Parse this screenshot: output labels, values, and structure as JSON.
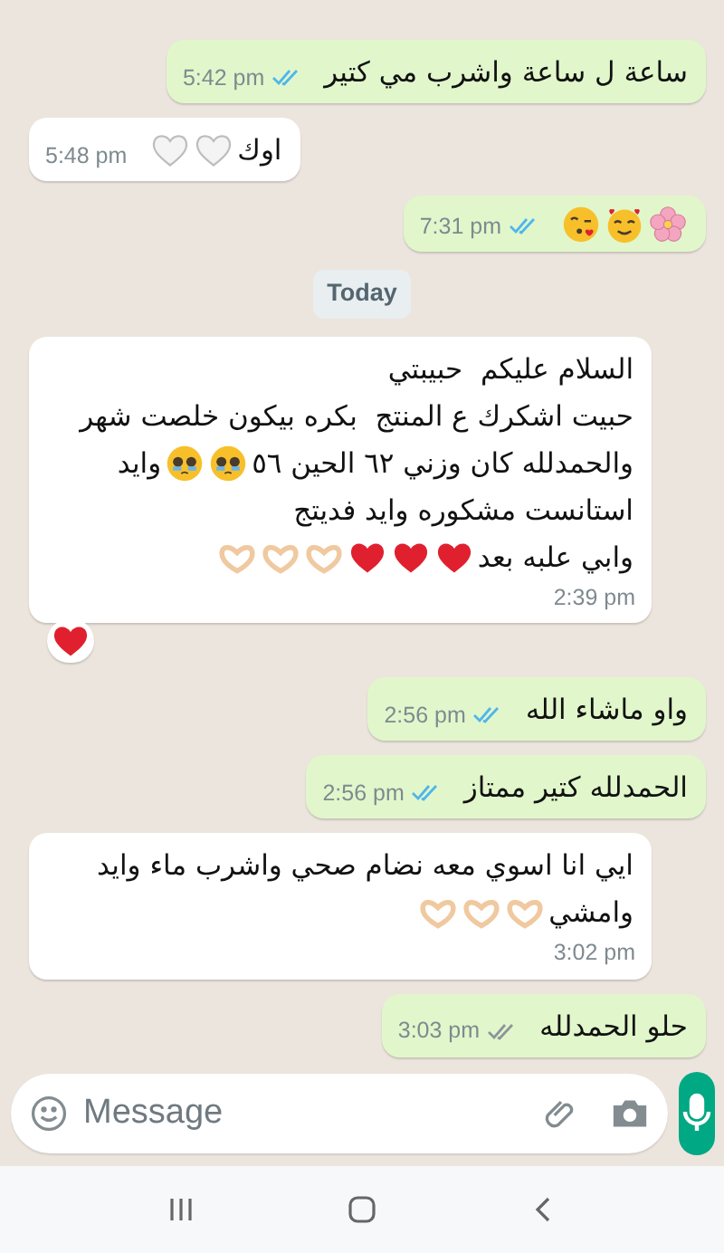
{
  "messages": [
    {
      "kind": "outgoing",
      "lines": [
        [
          {
            "kind": "text",
            "text": "ساعة ل ساعة واشرب مي كتير"
          }
        ]
      ],
      "time": "5:42 pm",
      "read": true
    },
    {
      "kind": "incoming",
      "lines": [
        [
          {
            "kind": "text",
            "text": "اوك"
          },
          {
            "kind": "outlineheart"
          },
          {
            "kind": "outlineheart"
          }
        ]
      ],
      "time": "5:48 pm"
    },
    {
      "kind": "outgoing",
      "lines": [
        [
          {
            "kind": "blossom"
          },
          {
            "kind": "lovestruck"
          },
          {
            "kind": "kiss"
          }
        ]
      ],
      "time": "7:31 pm",
      "read": true
    },
    {
      "kind": "date",
      "text": "Today"
    },
    {
      "kind": "incoming",
      "lines": [
        [
          {
            "kind": "text",
            "text": "السلام عليكم  حبيبتي"
          }
        ],
        [
          {
            "kind": "text",
            "text": "حبيت اشكرك ع المنتج  بكره بيكون خلصت شهر"
          }
        ],
        [
          {
            "kind": "text",
            "text": "والحمدلله كان وزني ٦٢ الحين ٥٦"
          },
          {
            "kind": "pleading"
          },
          {
            "kind": "pleading"
          },
          {
            "kind": "text",
            "text": "وايد"
          }
        ],
        [
          {
            "kind": "text",
            "text": "استانست مشكوره وايد فديتج"
          }
        ],
        [
          {
            "kind": "text",
            "text": "وابي علبه بعد"
          },
          {
            "kind": "heart"
          },
          {
            "kind": "heart"
          },
          {
            "kind": "heart"
          },
          {
            "kind": "hearthands"
          },
          {
            "kind": "hearthands"
          },
          {
            "kind": "hearthands"
          }
        ]
      ],
      "time": "2:39 pm",
      "reactions": [
        {
          "kind": "heart"
        }
      ]
    },
    {
      "kind": "outgoing",
      "lines": [
        [
          {
            "kind": "text",
            "text": "واو ماشاء الله"
          }
        ]
      ],
      "time": "2:56 pm",
      "read": true
    },
    {
      "kind": "outgoing",
      "lines": [
        [
          {
            "kind": "text",
            "text": "الحمدلله كتير ممتاز"
          }
        ]
      ],
      "time": "2:56 pm",
      "read": true
    },
    {
      "kind": "incoming",
      "lines": [
        [
          {
            "kind": "text",
            "text": "ايي انا اسوي معه نضام صحي واشرب ماء وايد"
          }
        ],
        [
          {
            "kind": "text",
            "text": "وامشي"
          },
          {
            "kind": "hearthands"
          },
          {
            "kind": "hearthands"
          },
          {
            "kind": "hearthands"
          }
        ]
      ],
      "time": "3:02 pm"
    },
    {
      "kind": "outgoing",
      "lines": [
        [
          {
            "kind": "text",
            "text": "حلو الحمدلله"
          }
        ]
      ],
      "time": "3:03 pm",
      "read": false
    }
  ],
  "composer": {
    "placeholder": "Message"
  }
}
